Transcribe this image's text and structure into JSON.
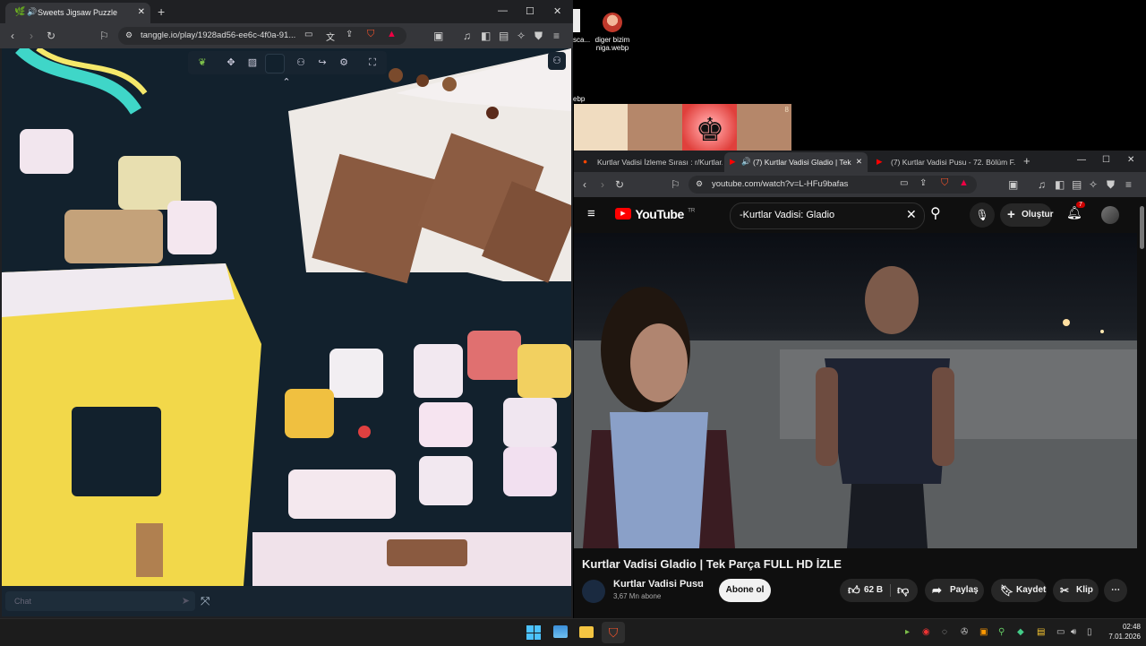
{
  "desktop": {
    "file1": "diger bizim niga.webp",
    "file_partial": "ebp",
    "file_partial2": "sca...",
    "board_rank": "8"
  },
  "left_browser": {
    "tab_title": "Sweets Jigsaw Puzzle",
    "url": "tanggle.io/play/1928ad56-ee6c-4f0a-91...",
    "new_tab": "+",
    "chat_placeholder": "Chat"
  },
  "right_browser": {
    "tabs": [
      "Kurtlar Vadisi İzleme Sırası : r/Kurtlar...",
      "(7) Kurtlar Vadisi Gladio | Tek...",
      "(7) Kurtlar Vadisi Pusu - 72. Bölüm F..."
    ],
    "new_tab": "+",
    "url": "youtube.com/watch?v=L-HFu9bafas",
    "youtube": {
      "logo": "YouTube",
      "region": "TR",
      "search_value": "-Kurtlar Vadisi: Gladio",
      "create_label": "Oluştur",
      "notif_count": "7",
      "video_title": "Kurtlar Vadisi Gladio | Tek Parça FULL HD İZLE",
      "channel_name": "Kurtlar Vadisi Pusu",
      "subscribers": "3,67 Mn abone",
      "subscribe_label": "Abone ol",
      "likes": "62 B",
      "share_label": "Paylaş",
      "save_label": "Kaydet",
      "clip_label": "Klip"
    }
  },
  "taskbar": {
    "time": "02:48",
    "date": "7.01.2026"
  }
}
